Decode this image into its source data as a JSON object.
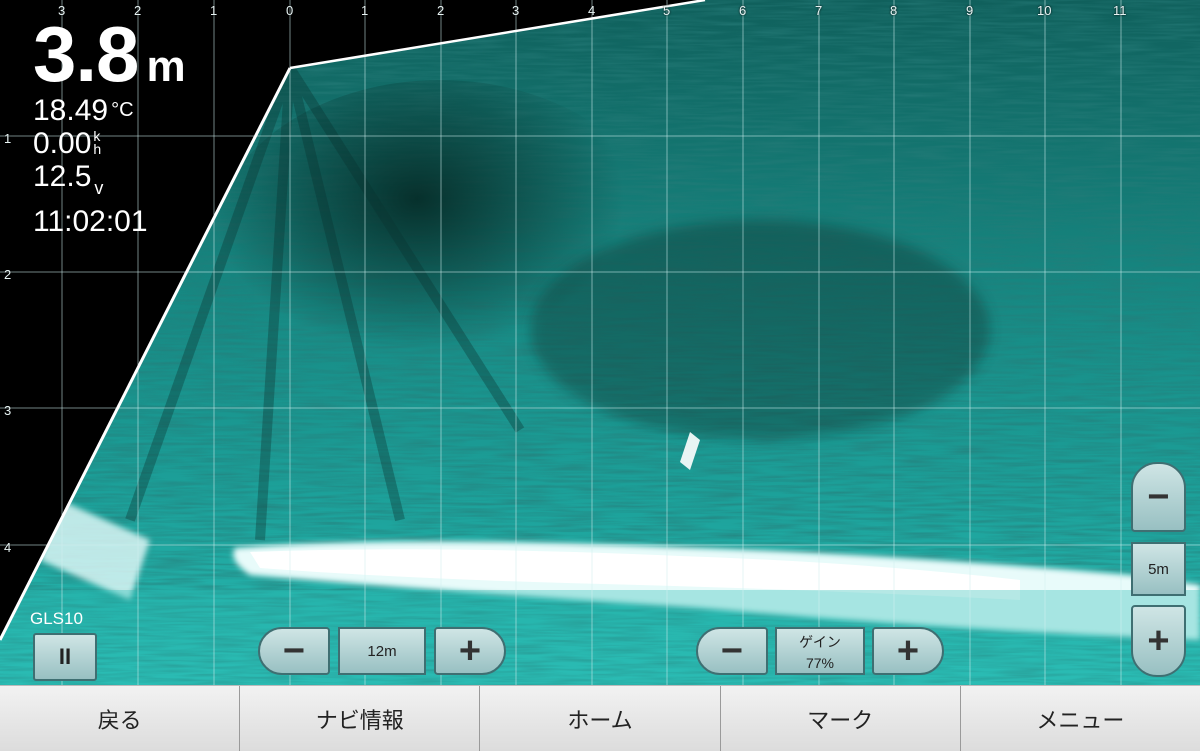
{
  "readout": {
    "depth_value": "3.8",
    "depth_unit": "m",
    "temperature_value": "18.49",
    "temperature_unit": "°C",
    "speed_value": "0.00",
    "speed_unit_top": "k",
    "speed_unit_bottom": "h",
    "voltage_value": "12.5",
    "voltage_unit": "v",
    "time": "11:02:01"
  },
  "top_axis_labels": [
    "3",
    "2",
    "1",
    "0",
    "1",
    "2",
    "3",
    "4",
    "5",
    "6",
    "7",
    "8",
    "9",
    "10",
    "11"
  ],
  "left_axis_labels": [
    "1",
    "2",
    "3",
    "4"
  ],
  "source_label": "GLS10",
  "pause_label": "II",
  "range_control": {
    "minus": "−",
    "value": "12m",
    "plus": "+"
  },
  "gain_control": {
    "minus": "−",
    "title": "ゲイン",
    "value": "77%",
    "plus": "+"
  },
  "zoom_control": {
    "minus": "−",
    "value": "5m",
    "plus": "+"
  },
  "nav": [
    {
      "label": "戻る"
    },
    {
      "label": "ナビ情報"
    },
    {
      "label": "ホーム"
    },
    {
      "label": "マーク"
    },
    {
      "label": "メニュー"
    }
  ],
  "colors": {
    "sonar_teal": "#1fb3ac",
    "sonar_dark": "#0b3f3c",
    "bottom_echo": "#ffffff"
  }
}
